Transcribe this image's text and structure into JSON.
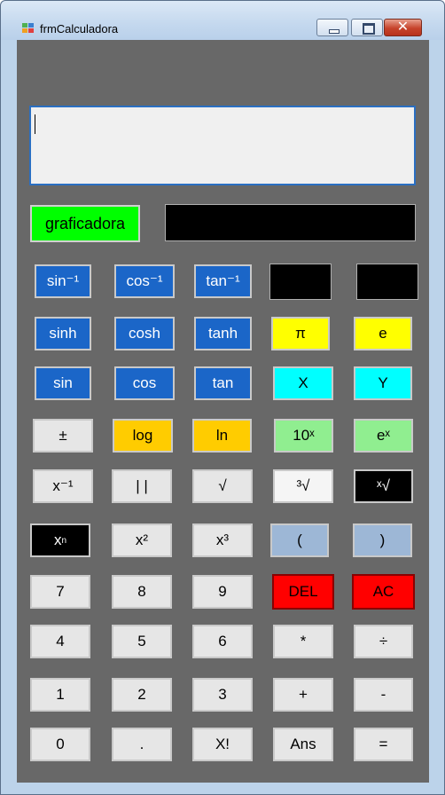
{
  "window": {
    "title": "frmCalculadora",
    "controls": {
      "close": "✕"
    }
  },
  "display": {
    "value": ""
  },
  "graph_button": "graficadora",
  "buttons": {
    "asin": "sin⁻¹",
    "acos": "cos⁻¹",
    "atan": "tan⁻¹",
    "sinh": "sinh",
    "cosh": "cosh",
    "tanh": "tanh",
    "pi": "π",
    "e": "e",
    "sin": "sin",
    "cos": "cos",
    "tan": "tan",
    "x": "X",
    "y": "Y",
    "plusminus": "±",
    "log": "log",
    "ln": "ln",
    "pow10": "10ˣ",
    "exp": "eˣ",
    "inverse": "x⁻¹",
    "abs": "|  |",
    "sqrt": "√",
    "cbrt": "³√",
    "xroot": "ˣ√",
    "xn_base": "x",
    "xn_exp": "n",
    "square": "x²",
    "cube": "x³",
    "lparen": "(",
    "rparen": ")",
    "d7": "7",
    "d8": "8",
    "d9": "9",
    "del": "DEL",
    "ac": "AC",
    "d4": "4",
    "d5": "5",
    "d6": "6",
    "mul": "*",
    "div": "÷",
    "d1": "1",
    "d2": "2",
    "d3": "3",
    "add": "+",
    "sub": "-",
    "d0": "0",
    "dot": ".",
    "fact": "X!",
    "ans": "Ans",
    "eq": "="
  },
  "colors": {
    "form_background": "#686868",
    "trig_button": "#1b66c8",
    "graph_button": "#00ff00",
    "delete_buttons": "#ff0000"
  }
}
